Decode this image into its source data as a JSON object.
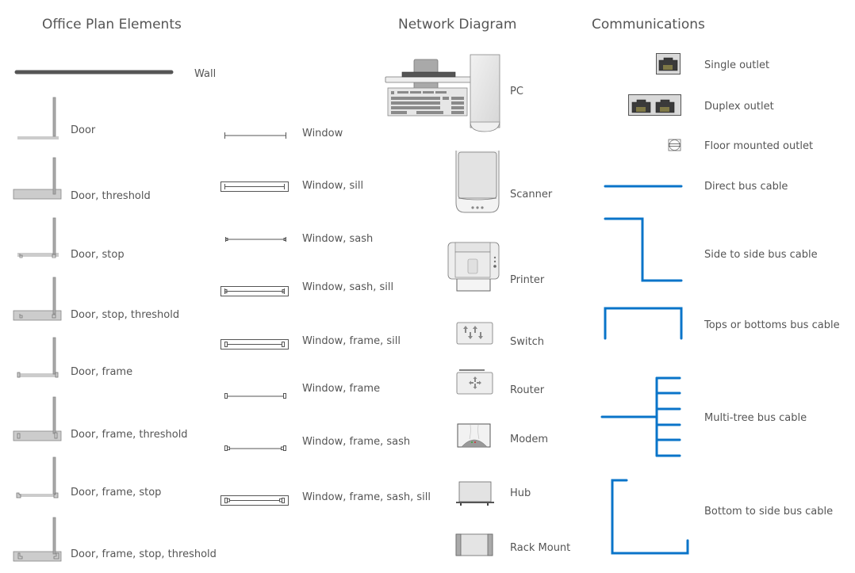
{
  "sections": {
    "office": {
      "title": "Office Plan Elements",
      "wall": "Wall",
      "doors": [
        "Door",
        "Door, threshold",
        "Door, stop",
        "Door, stop, threshold",
        "Door, frame",
        "Door, frame, threshold",
        "Door, frame, stop",
        "Door, frame, stop, threshold"
      ],
      "windows": [
        "Window",
        "Window, sill",
        "Window, sash",
        "Window, sash, sill",
        "Window, frame, sill",
        "Window, frame",
        "Window, frame, sash",
        "Window, frame, sash, sill"
      ]
    },
    "network": {
      "title": "Network Diagram",
      "items": [
        "PC",
        "Scanner",
        "Printer",
        "Switch",
        "Router",
        "Modem",
        "Hub",
        "Rack Mount"
      ]
    },
    "comms": {
      "title": "Communications",
      "items": [
        "Single outlet",
        "Duplex outlet",
        "Floor mounted outlet",
        "Direct bus cable",
        "Side to side bus cable",
        "Tops or bottoms bus cable",
        "Multi-tree bus cable",
        "Bottom to side bus cable"
      ]
    }
  },
  "colors": {
    "cable": "#0a74c9",
    "wall": "#555555",
    "door_fill": "#cccccc",
    "door_stroke": "#888888",
    "line": "#555555"
  }
}
